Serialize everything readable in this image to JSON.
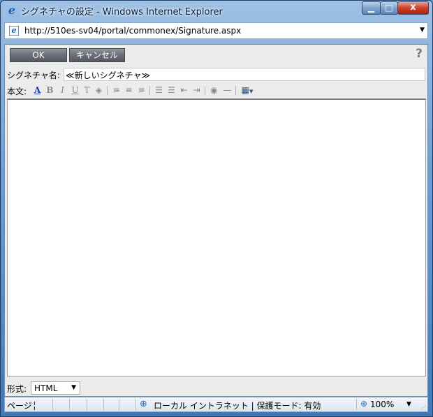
{
  "window": {
    "title": "シグネチャの設定 - Windows Internet Explorer",
    "min_glyph": "▁",
    "max_glyph": "□",
    "close_glyph": "x"
  },
  "address": {
    "url": "http://510es-sv04/portal/commonex/Signature.aspx",
    "dropdown_glyph": "▼"
  },
  "actions": {
    "ok_label": "OK",
    "cancel_label": "キャンセル",
    "help_glyph": "?"
  },
  "signature_name": {
    "label": "シグネチャ名:",
    "value": "≪新しいシグネチャ≫"
  },
  "editor_toolbar": {
    "label": "本文:",
    "icons": {
      "font_color": "A",
      "bold": "B",
      "italic": "I",
      "underline": "U",
      "font_size": "T",
      "background": "◈",
      "align_left": "≡",
      "align_center": "≡",
      "align_right": "≡",
      "ordered_list": "☰",
      "unordered_list": "☰",
      "outdent": "⇤",
      "indent": "⇥",
      "link": "◉",
      "horizontal_rule": "—",
      "table": "▦"
    }
  },
  "format": {
    "label": "形式:",
    "selected": "HTML",
    "dropdown_glyph": "▼"
  },
  "statusbar": {
    "status_text": "ページ╎",
    "zone": "ローカル イントラネット | 保護モード: 有効",
    "zoom": "100%",
    "zoom_dropdown_glyph": "▼",
    "grip_glyph": "⋰"
  }
}
